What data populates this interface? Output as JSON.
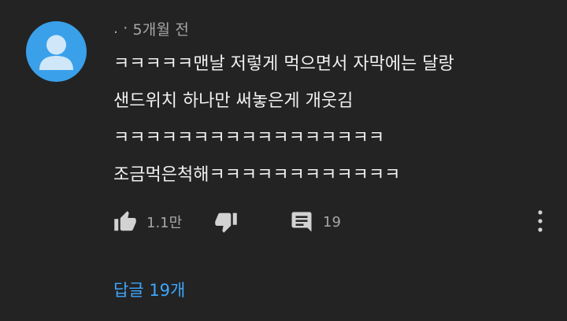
{
  "comment": {
    "author": ".",
    "separator": "·",
    "time": "5개월 전",
    "lines": [
      "ㅋㅋㅋㅋㅋ맨날 저렇게 먹으면서 자막에는 달랑",
      "샌드위치 하나만 써놓은게 개웃김",
      "ㅋㅋㅋㅋㅋㅋㅋㅋㅋㅋㅋㅋㅋㅋㅋㅋㅋ",
      "조금먹은척해ㅋㅋㅋㅋㅋㅋㅋㅋㅋㅋㅋㅋ"
    ]
  },
  "actions": {
    "like_count": "1.1만",
    "reply_count": "19"
  },
  "replies_label": "답글 19개",
  "colors": {
    "background": "#232323",
    "text": "#f1f1f1",
    "muted": "#a6a6a6",
    "avatar": "#3aa0ea",
    "link": "#3ea6ff"
  },
  "icons": {
    "like": "thumb-up-icon",
    "dislike": "thumb-down-icon",
    "reply": "comment-icon",
    "more": "more-vertical-icon"
  }
}
